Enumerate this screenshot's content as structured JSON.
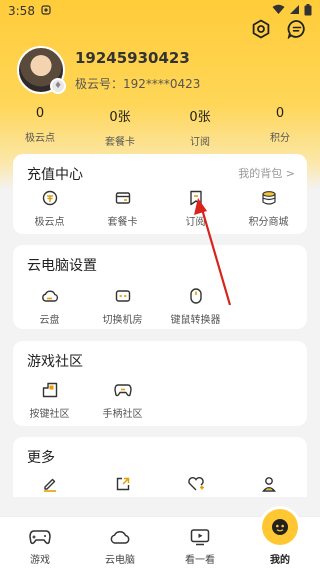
{
  "status_bar": {
    "time": "3:58"
  },
  "profile": {
    "phone": "19245930423",
    "account_id": "极云号：192****0423"
  },
  "stats": [
    {
      "value": "0",
      "label": "极云点"
    },
    {
      "value": "0张",
      "label": "套餐卡"
    },
    {
      "value": "0张",
      "label": "订阅"
    },
    {
      "value": "0",
      "label": "积分"
    }
  ],
  "recharge": {
    "title": "充值中心",
    "link": "我的背包 >",
    "items": [
      {
        "label": "极云点",
        "icon": "coin-icon"
      },
      {
        "label": "套餐卡",
        "icon": "card-icon"
      },
      {
        "label": "订阅",
        "icon": "bookmark-icon"
      },
      {
        "label": "积分商城",
        "icon": "database-coins-icon"
      }
    ]
  },
  "settings": {
    "title": "云电脑设置",
    "items": [
      {
        "label": "云盘",
        "icon": "cloud-icon"
      },
      {
        "label": "切换机房",
        "icon": "server-icon"
      },
      {
        "label": "键鼠转换器",
        "icon": "mouse-icon"
      }
    ]
  },
  "community": {
    "title": "游戏社区",
    "items": [
      {
        "label": "按键社区",
        "icon": "keys-icon"
      },
      {
        "label": "手柄社区",
        "icon": "gamepad-icon"
      }
    ]
  },
  "more": {
    "title": "更多",
    "items": [
      {
        "icon": "pencil-icon"
      },
      {
        "icon": "share-icon"
      },
      {
        "icon": "heart-plus-icon"
      },
      {
        "icon": "person-icon"
      }
    ]
  },
  "bottom_nav": [
    {
      "label": "游戏",
      "icon": "gamepad-icon"
    },
    {
      "label": "云电脑",
      "icon": "cloud-icon"
    },
    {
      "label": "看一看",
      "icon": "tv-icon"
    },
    {
      "label": "我的",
      "icon": "avatar-face-icon"
    }
  ],
  "colors": {
    "accent": "#ffc833",
    "arrow": "#d9241c"
  }
}
